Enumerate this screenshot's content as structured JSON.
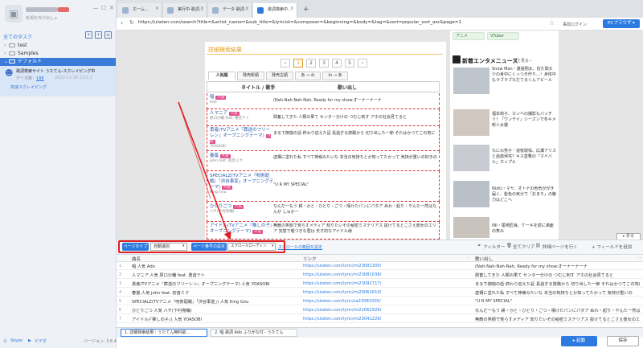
{
  "left": {
    "user_sub": "新規を呼び出し ▸",
    "task_list_title": "全てのタスク",
    "tree": [
      {
        "label": "test",
        "arrow": "›"
      },
      {
        "label": "Samples",
        "arrow": "›"
      },
      {
        "label": "デフォルト",
        "arrow": "⌄"
      }
    ],
    "task": {
      "name": "歌詞検索サイト うたてん-スクレイピング中",
      "data_label": "データ数：",
      "data_count": "188",
      "date": "2023-11-16 13:2.1",
      "mode": "高速スクレイピング"
    },
    "skype": "Skype",
    "web": "ビデオ",
    "version": "バージョン: 3.6.4"
  },
  "browser": {
    "tabs": [
      "ホーム...",
      "実行中-歌詞...",
      "データ-歌詞...",
      "歌詞検索中..."
    ],
    "url": "https://utaten.com/search?title=&artist_name=&sub_title=&lyricist=&composer=&beginning=&body=&tag=&sort=popular_sort_asc&page=1",
    "right_link": "事前ログイン",
    "pc_button": "PCブラウザ ▾"
  },
  "site": {
    "result_title": "詳細検索結果",
    "pages": [
      "‹",
      "1",
      "2",
      "3",
      "4",
      "5",
      "›"
    ],
    "sort_tabs": [
      "人気順",
      "発売新順",
      "発売古順",
      "あ → わ",
      "わ → あ"
    ],
    "col_title": "タイトル / 歌手",
    "col_lyric": "歌い出し",
    "badge": "人気",
    "songs": [
      {
        "title": "唱",
        "artist": "Ado",
        "lyric": "(Nah-Nah-Nah-Nah, Ready for my show:オーナーナーナ"
      },
      {
        "title": "人マニア",
        "artist": "原口沙輔 feat. 重音テト",
        "lyric": "興奮してきた 人類の果て センター分けの つむじ刺す アホの社会見てると"
      },
      {
        "title": "勇者(TVアニメ『葬送のフリーレン』オープニングテーマ)",
        "artist": "YOASOBI",
        "lyric": "まるで御伽の話 終わり迎えた証 長過ぎる旅路から 切り出した一節 それはかつてこの地に"
      },
      {
        "title": "春嵐",
        "artist": "john feat. 初音ミク",
        "lyric": "虚構に塗れた私 すべて神様みたいな 本当の気持ちとか知ってたかって 気持が重いの好きの"
      },
      {
        "title": "SPECIALZ(TVアニメ『呪術廻戦』「渋谷事変」オープニングテーマ)",
        "artist": "King Gnu",
        "lyric": "\"U R MY SPECIAL\""
      },
      {
        "title": "ひとりごつ",
        "artist": "ハチ(下村亮輔)",
        "lyric": "なんだーもう 耕・かと・ひとり・ごつ・嘆けたパンにパタア ぬわ・起り・やんた一然はなんが しゅかー"
      },
      {
        "title": "アイドル(TVアニメ『推しの子』オープニングテーマ)",
        "artist": "YOASOBI",
        "lyric": "無敵の笑顔で荒らすメディア 知りたいその秘密ミステリアス 抜けてるとこさえ彼女のエリア 完璧で嘘つきな君は 天才的なアイドル様"
      }
    ],
    "right": {
      "tags": [
        "アニメ",
        "VTuber"
      ],
      "news_title": "新着エンタメニュース",
      "news_more": "全て見る ›",
      "news": [
        "Snow Man・渡邊翔太、佐久間大介の身中にくっつき作り…！身体中もラブラブなだてるくんアピール",
        "福本莉子、カンベの撮影もバッチリ！「ワンデイ」シーズンで冬キメ新人女優",
        "なにわ男子・道枝駿佑、広瀬アリスと過激帰宅？キス直撃の「マイバル」カップル",
        "NiziU・マヤ、オトナの色気ががき届く、髪色の気分で「おまり」の魅力はどこへ",
        "INI・尾崎匠海、ケーキを前に満面の笑み"
      ],
      "fold": "▸ 折る"
    }
  },
  "toolbar": {
    "page_type": "ページタイプ",
    "page_select": "自動識別",
    "scroll_label": "ページ番号の設定",
    "scroll_select": "スクロールローディン",
    "range_link": "スクロールの範囲を設定",
    "filter": "フィルター",
    "clear": "全てクリア",
    "detail": "詳細ページを行く",
    "add_field": "+ フィールドを追加"
  },
  "datatable": {
    "headers": [
      "曲名",
      "リンク",
      "歌い出し"
    ],
    "rows": [
      {
        "num": "1",
        "name": "唱 人気 Ado",
        "link": "https://utaten.com/lyric/mi23091305/",
        "lyric": "(Nah-Nah-Nah-Nah, Ready for my show:オーナーナーナ"
      },
      {
        "num": "2",
        "name": "人マニア 人気 原口沙輔 feat. 重音テト",
        "link": "https://utaten.com/lyric/mi23081038/",
        "lyric": "興奮してきた 人類の果て センター分けの つむじ刺す アホの社会見てると"
      },
      {
        "num": "3",
        "name": "勇者(TVアニメ『葬送のフリーレン』オープニングテーマ) 人気 YOASOBI",
        "link": "https://utaten.com/lyric/mi23092717/",
        "lyric": "まるで御伽の話 終わり迎えた証 長過ぎる旅路から 切り出した一節 それはかつてこの地に"
      },
      {
        "num": "4",
        "name": "春嵐 人気 john feat. 初音ミク",
        "link": "https://utaten.com/lyric/mi20061610/",
        "lyric": "虚構に塗れた私 すべて神様みたいな 本当の気持ちとか知ってたかって 気持が重いの"
      },
      {
        "num": "5",
        "name": "SPECIALZ(TVアニメ『呪術廻戦』「渋谷事変」) 人気 King Gnu",
        "link": "https://utaten.com/lyric/sa23081005/",
        "lyric": "\"U R MY SPECIAL\""
      },
      {
        "num": "6",
        "name": "ひとりごつ 人気 ハチ(下村亮輔)",
        "link": "https://utaten.com/lyric/mi22062929/",
        "lyric": "なんだーもう 耕・かと・ひとり・ごつ・嘆けたパンにパタア ぬわ・起り・やんた一然はなんが"
      },
      {
        "num": "7",
        "name": "アイドル(『推しの子』) 人気 YOASOBI",
        "link": "https://utaten.com/lyric/mi23041229/",
        "lyric": "無敵の笑顔で荒らすメディア 知りたいその秘密ミステリアス 抜けてるとこさえ彼女のエリア"
      }
    ]
  },
  "bottom": {
    "tabs": [
      "1. 詳細検索結果｜うたてん無料歌...",
      "2. 唱 歌詞 Ado ふりがな付 - うたてん"
    ],
    "stop": "▸ 起動",
    "save": "保存"
  },
  "colors": {
    "accent": "#2d7be0",
    "highlight": "#e02020",
    "orange": "#e49a17"
  }
}
